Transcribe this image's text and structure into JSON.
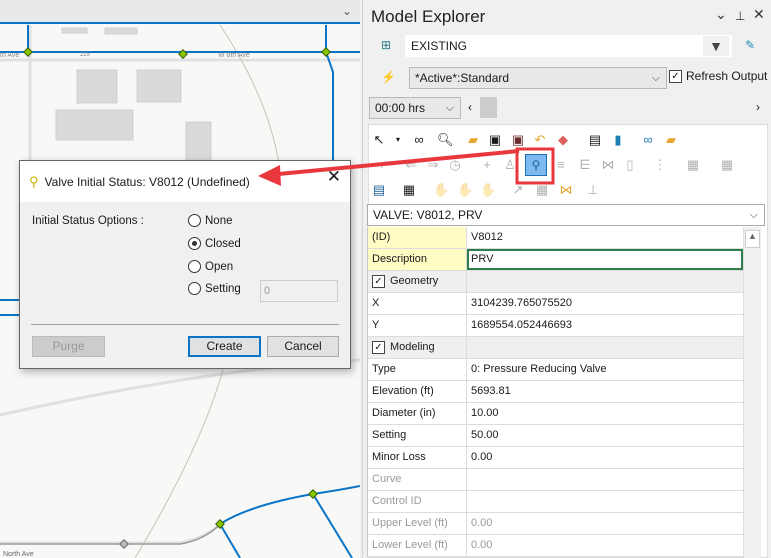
{
  "map": {
    "street_labels": [
      "th Ave",
      "W 8th Ave",
      "North Ave"
    ],
    "route_shield": "225"
  },
  "panel": {
    "title": "Model Explorer",
    "controls": {
      "menu": "⌄",
      "pin": "📌",
      "close": "✕"
    },
    "scenario": "EXISTING",
    "alternative": "*Active*:Standard",
    "refresh_output": {
      "label": "Refresh Output",
      "checked": true
    },
    "time": "00:00 hrs",
    "element_selector": "VALVE: V8012, PRV",
    "properties": [
      {
        "label": "(ID)",
        "value": "V8012",
        "kind": "key"
      },
      {
        "label": "Description",
        "value": "PRV",
        "kind": "key"
      },
      {
        "label": "Geometry",
        "value": "",
        "kind": "category"
      },
      {
        "label": "X",
        "value": "3104239.765075520",
        "kind": "normal"
      },
      {
        "label": "Y",
        "value": "1689554.052446693",
        "kind": "normal"
      },
      {
        "label": "Modeling",
        "value": "",
        "kind": "category"
      },
      {
        "label": "Type",
        "value": "0: Pressure Reducing Valve",
        "kind": "normal"
      },
      {
        "label": "Elevation (ft)",
        "value": "5693.81",
        "kind": "normal"
      },
      {
        "label": "Diameter (in)",
        "value": "10.00",
        "kind": "normal"
      },
      {
        "label": "Setting",
        "value": "50.00",
        "kind": "normal"
      },
      {
        "label": "Minor Loss",
        "value": "0.00",
        "kind": "normal"
      },
      {
        "label": "Curve",
        "value": "",
        "kind": "disabled"
      },
      {
        "label": "Control ID",
        "value": "",
        "kind": "disabled"
      },
      {
        "label": "Upper Level (ft)",
        "value": "0.00",
        "kind": "disabled"
      },
      {
        "label": "Lower Level (ft)",
        "value": "0.00",
        "kind": "disabled"
      }
    ]
  },
  "dialog": {
    "title": "Valve Initial Status: V8012 (Undefined)",
    "options_label": "Initial Status Options :",
    "options": [
      "None",
      "Closed",
      "Open",
      "Setting"
    ],
    "selected": "Closed",
    "setting_value": "0",
    "purge": "Purge",
    "create": "Create",
    "cancel": "Cancel"
  },
  "colors": {
    "annotation": "#e8383d",
    "network": "#0a74c8",
    "highlight": "#7cb9f0"
  }
}
